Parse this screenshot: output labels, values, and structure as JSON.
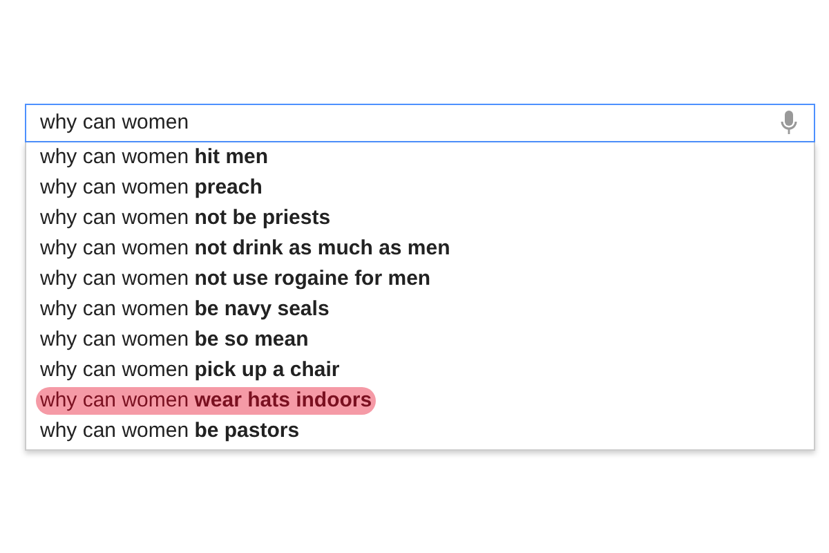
{
  "search": {
    "value": "why can women"
  },
  "suggestions": [
    {
      "text": "why can women **hit men**",
      "highlighted": false
    },
    {
      "text": "why can women **preach**",
      "highlighted": false
    },
    {
      "text": "why can women **not be priests**",
      "highlighted": false
    },
    {
      "text": "why can women **not drink as much as men**",
      "highlighted": false
    },
    {
      "text": "why can women **not use rogaine for men**",
      "highlighted": false
    },
    {
      "text": "why can women **be navy seals**",
      "highlighted": false
    },
    {
      "text": "why can women **be so mean**",
      "highlighted": false
    },
    {
      "text": "why can women **pick up a chair**",
      "highlighted": false
    },
    {
      "text": "why can women **wear hats indoors**",
      "highlighted": true
    },
    {
      "text": "why can women **be pastors**",
      "highlighted": false
    }
  ]
}
